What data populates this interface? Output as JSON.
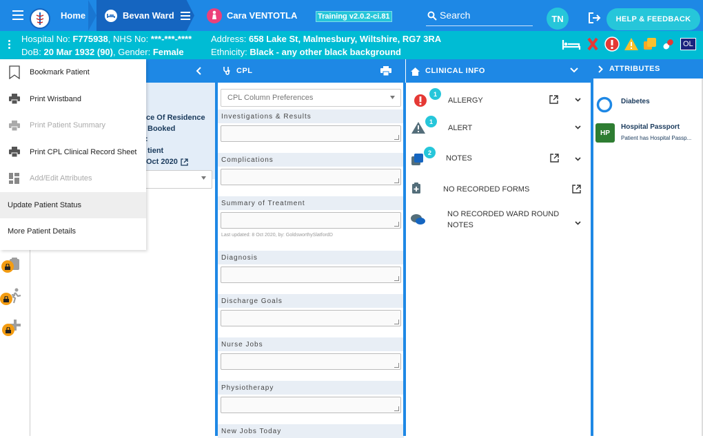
{
  "topbar": {
    "home_label": "Home",
    "ward_label": "Bevan Ward",
    "patient_name": "Cara VENTOTLA",
    "version": "Training v2.0.2-ci.81",
    "search_label": "Search",
    "user_initials": "TN",
    "help_label": "HELP & FEEDBACK"
  },
  "patient": {
    "hospital_label": "Hospital No:",
    "hospital_no": "F775938",
    "nhs_label": ", NHS No:",
    "nhs_no": "***-***-****",
    "dob_label": "DoB:",
    "dob": "20 Mar 1932 (90)",
    "gender_label": ", Gender:",
    "gender": "Female",
    "address_label": "Address:",
    "address": "658 Lake St, Malmesbury, Wiltshire, RG7 3RA",
    "ethnicity_label": "Ethnicity:",
    "ethnicity": "Black - any other black background",
    "ol_badge": "OL"
  },
  "menu": {
    "items": [
      {
        "label": "Bookmark Patient"
      },
      {
        "label": "Print Wristband"
      },
      {
        "label": "Print Patient Summary"
      },
      {
        "label": "Print CPL Clinical Record Sheet"
      },
      {
        "label": "Add/Edit Attributes"
      },
      {
        "label": "Update Patient Status"
      },
      {
        "label": "More Patient Details"
      }
    ]
  },
  "left_panel": {
    "line1": "ce Of Residence",
    "line2": "Booked",
    "line3": ":",
    "line4": "tient",
    "line5": "Oct 2020"
  },
  "cpl": {
    "title": "CPL",
    "preferences_placeholder": "CPL Column Preferences",
    "sections": [
      {
        "label": "Investigations & Results"
      },
      {
        "label": "Complications"
      },
      {
        "label": "Summary of Treatment"
      },
      {
        "label": "Diagnosis"
      },
      {
        "label": "Discharge Goals"
      },
      {
        "label": "Nurse Jobs"
      },
      {
        "label": "Physiotherapy"
      },
      {
        "label": "New Jobs Today"
      }
    ],
    "last_updated": "Last updated: 8 Oct 2020, by: GoldsworthySlatfordD"
  },
  "clinical": {
    "title": "CLINICAL INFO",
    "allergy_label": "ALLERGY",
    "allergy_count": "1",
    "alert_label": "ALERT",
    "alert_count": "1",
    "notes_label": "NOTES",
    "notes_count": "2",
    "forms_label": "NO RECORDED FORMS",
    "ward_line1": "NO RECORDED WARD ROUND",
    "ward_line2": "NOTES"
  },
  "attributes": {
    "title": "ATTRIBUTES",
    "diabetes_label": "Diabetes",
    "hp_initials": "HP",
    "hp_title": "Hospital Passport",
    "hp_desc": "Patient has Hospital Passp..."
  },
  "colors": {
    "primary": "#1e88e5",
    "patient_bar": "#00bcd4",
    "badge": "#26c6da",
    "alert_red": "#e53935",
    "warning": "#fbc02d",
    "lock": "#f39c12",
    "hp_green": "#2e7d32"
  }
}
